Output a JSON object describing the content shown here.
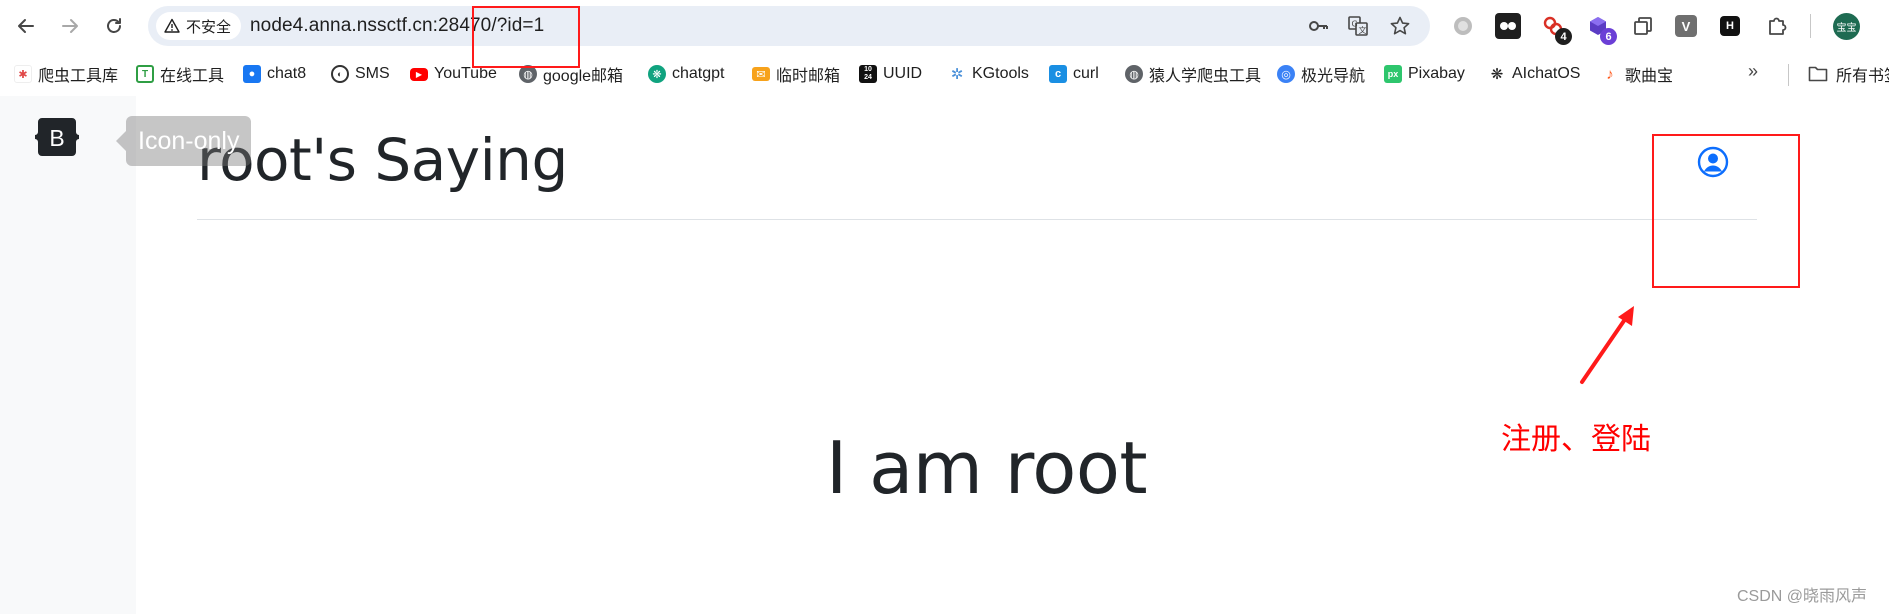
{
  "browser": {
    "nav": {
      "back_icon": "arrow-left-icon",
      "forward_icon": "arrow-right-icon",
      "reload_icon": "reload-icon"
    },
    "address_bar": {
      "security_label": "不安全",
      "url_host": "node4.anna.nssctf.cn:28470",
      "url_path": "/?id=1"
    },
    "extensions": [
      {
        "name": "globe-extension",
        "badge": ""
      },
      {
        "name": "game-extension",
        "badge": ""
      },
      {
        "name": "link-extension",
        "badge": "4"
      },
      {
        "name": "cube-extension",
        "badge": "6"
      },
      {
        "name": "copy-extension",
        "badge": ""
      },
      {
        "name": "v-extension",
        "label": "V",
        "badge": ""
      },
      {
        "name": "h-extension",
        "label": "H",
        "badge": ""
      },
      {
        "name": "puzzle-extension",
        "badge": ""
      }
    ],
    "profile_label": "宝宝"
  },
  "bookmarks": [
    {
      "label": "爬虫工具库",
      "icon": "spider-icon",
      "color": "#e04848"
    },
    {
      "label": "在线工具",
      "icon": "tools-icon",
      "color": "#2f9e44"
    },
    {
      "label": "chat8",
      "icon": "chat-icon",
      "color": "#1877f2"
    },
    {
      "label": "SMS",
      "icon": "sms-icon",
      "color": "#333333"
    },
    {
      "label": "YouTube",
      "icon": "youtube-icon",
      "color": "#ff0000"
    },
    {
      "label": "google邮箱",
      "icon": "globe-icon",
      "color": "#5f6368"
    },
    {
      "label": "chatgpt",
      "icon": "openai-icon",
      "color": "#10a37f"
    },
    {
      "label": "临时邮箱",
      "icon": "mail-icon",
      "color": "#f7a21b"
    },
    {
      "label": "UUID",
      "icon": "uuid-icon",
      "color": "#111111"
    },
    {
      "label": "KGtools",
      "icon": "bug-icon",
      "color": "#4a90d9"
    },
    {
      "label": "curl",
      "icon": "curl-icon",
      "color": "#1a8fe3"
    },
    {
      "label": "猿人学爬虫工具",
      "icon": "globe-icon",
      "color": "#5f6368"
    },
    {
      "label": "极光导航",
      "icon": "search-icon",
      "color": "#3b82f6"
    },
    {
      "label": "Pixabay",
      "icon": "pixabay-icon",
      "color": "#2ec66d"
    },
    {
      "label": "AIchatOS",
      "icon": "openai-icon",
      "color": "#222222"
    },
    {
      "label": "歌曲宝",
      "icon": "music-icon",
      "color": "#ff5a1f"
    }
  ],
  "bookmarks_folder_label": "所有书签",
  "page": {
    "brand_letter": "B",
    "tooltip": "Icon-only",
    "title": "root's Saying",
    "main_text": "I am root",
    "watermark": "CSDN @晓雨风声"
  },
  "annotations": {
    "label": "注册、登陆",
    "color": "#ff0000"
  },
  "colors": {
    "accent": "#0d6efd",
    "brand_bg": "#212529",
    "sidebar_bg": "#f8f9fa",
    "annotation": "#ff1a1a"
  }
}
